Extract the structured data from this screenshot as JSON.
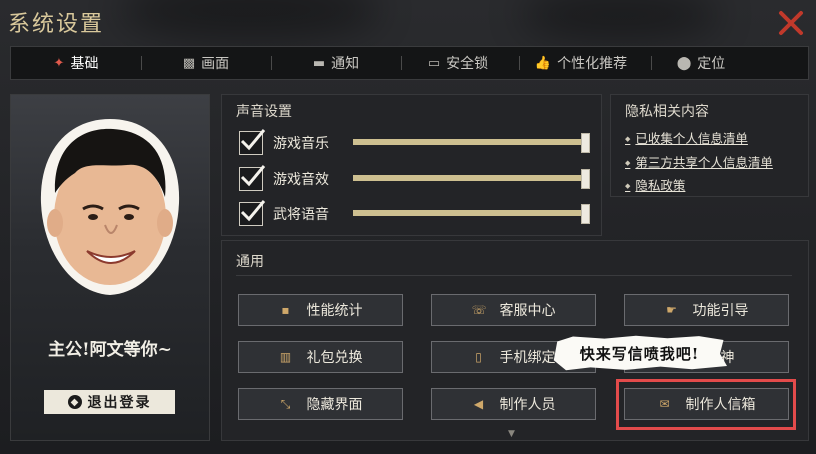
{
  "window": {
    "title": "系统设置",
    "close_icon": "close-x-icon",
    "accent": "#c0392b"
  },
  "tabs": [
    {
      "label": "基础",
      "icon": "gear-flame-icon",
      "active": true
    },
    {
      "label": "画面",
      "icon": "picture-icon",
      "active": false
    },
    {
      "label": "通知",
      "icon": "chat-bubble-icon",
      "active": false
    },
    {
      "label": "安全锁",
      "icon": "keyboard-lock-icon",
      "active": false
    },
    {
      "label": "个性化推荐",
      "icon": "thumbs-up-icon",
      "active": false
    },
    {
      "label": "定位",
      "icon": "location-pin-icon",
      "active": false
    }
  ],
  "profile": {
    "caption": "主公!阿文等你~",
    "logout_label": "退出登录"
  },
  "sound": {
    "title": "声音设置",
    "items": [
      {
        "label": "游戏音乐",
        "checked": true,
        "level": 1.0
      },
      {
        "label": "游戏音效",
        "checked": true,
        "level": 1.0
      },
      {
        "label": "武将语音",
        "checked": true,
        "level": 1.0
      }
    ]
  },
  "privacy": {
    "title": "隐私相关内容",
    "links": [
      "已收集个人信息清单",
      "第三方共享个人信息清单",
      "隐私政策"
    ]
  },
  "general": {
    "title": "通用",
    "buttons": [
      {
        "label": "性能统计",
        "icon": "chat-dots-icon"
      },
      {
        "label": "客服中心",
        "icon": "phone-icon"
      },
      {
        "label": "功能引导",
        "icon": "pointer-hand-icon"
      },
      {
        "label": "礼包兑换",
        "icon": "gift-icon"
      },
      {
        "label": "手机绑定",
        "icon": "mobile-phone-icon"
      },
      {
        "label": "大神",
        "icon": "star-icon"
      },
      {
        "label": "隐藏界面",
        "icon": "expand-arrows-icon"
      },
      {
        "label": "制作人员",
        "icon": "megaphone-icon"
      },
      {
        "label": "制作人信箱",
        "icon": "envelope-icon"
      }
    ]
  },
  "bubble": {
    "text": "快来写信喷我吧!"
  }
}
